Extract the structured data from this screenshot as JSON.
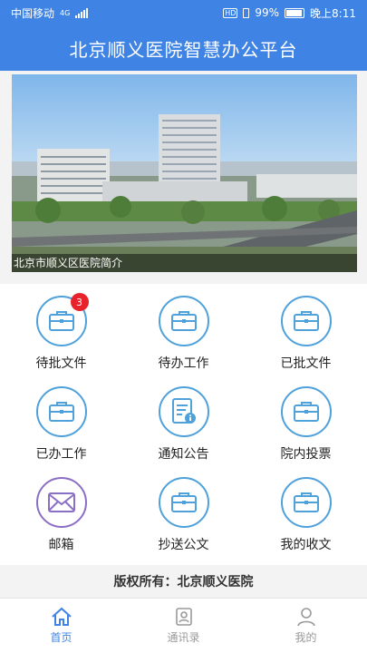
{
  "status_bar": {
    "carrier": "中国移动",
    "signal_tag": "4G",
    "battery": "99%",
    "time": "晚上8:11"
  },
  "app": {
    "title": "北京顺义医院智慧办公平台"
  },
  "banner": {
    "caption": "北京市顺义区医院简介"
  },
  "grid": {
    "items": [
      {
        "label": "待批文件",
        "icon": "briefcase-icon",
        "badge": "3"
      },
      {
        "label": "待办工作",
        "icon": "briefcase-icon"
      },
      {
        "label": "已批文件",
        "icon": "briefcase-icon"
      },
      {
        "label": "已办工作",
        "icon": "briefcase-icon"
      },
      {
        "label": "通知公告",
        "icon": "notice-document-icon"
      },
      {
        "label": "院内投票",
        "icon": "briefcase-icon"
      },
      {
        "label": "邮箱",
        "icon": "envelope-icon"
      },
      {
        "label": "抄送公文",
        "icon": "briefcase-icon"
      },
      {
        "label": "我的收文",
        "icon": "briefcase-icon"
      }
    ]
  },
  "footer": {
    "copyright": "版权所有：北京顺义医院"
  },
  "tabbar": {
    "tabs": [
      {
        "label": "首页",
        "icon": "home-icon",
        "active": true
      },
      {
        "label": "通讯录",
        "icon": "contacts-icon"
      },
      {
        "label": "我的",
        "icon": "profile-icon"
      }
    ]
  },
  "colors": {
    "primary": "#3f84e5",
    "icon_blue": "#4ea1db",
    "mail_purple": "#8b6fc5",
    "badge_red": "#e8222b"
  }
}
